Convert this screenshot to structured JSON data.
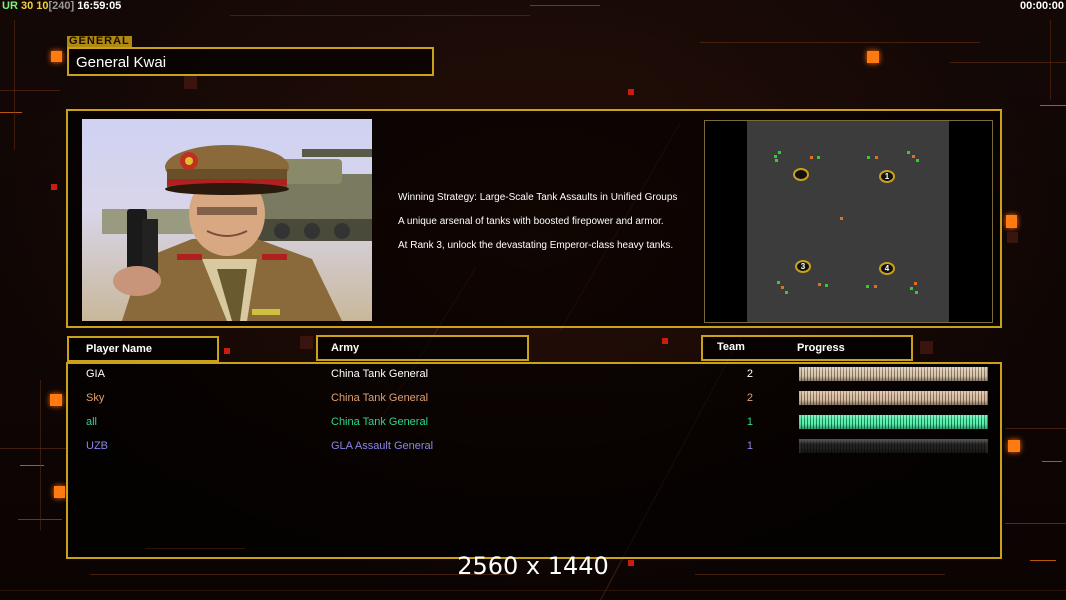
{
  "hud": {
    "ur_label": "UR",
    "fps": "30",
    "value10": "10",
    "bracket_value": "[240]",
    "clock": "16:59:05",
    "timer": "00:00:00"
  },
  "general": {
    "tag": "GENERAL",
    "name": "General Kwai",
    "portrait_icon": "general-portrait",
    "description": [
      "Winning Strategy: Large-Scale Tank Assaults in Unified Groups",
      "A unique arsenal of tanks with boosted firepower and armor.",
      "At Rank 3, unlock the devastating Emperor-class heavy tanks."
    ]
  },
  "minimap": {
    "start_positions": [
      "",
      "1",
      "3",
      "4"
    ]
  },
  "columns": {
    "player_name": "Player Name",
    "army": "Army",
    "team": "Team",
    "progress": "Progress"
  },
  "players": [
    {
      "name": "GIA",
      "army": "China Tank General",
      "team": "2",
      "progress": 1.0,
      "color": "#ffffff",
      "bar_color": "#d9c9b0",
      "bar_accent": "#8a7460"
    },
    {
      "name": "Sky",
      "army": "China Tank General",
      "team": "2",
      "progress": 1.0,
      "color": "#e0a070",
      "bar_color": "#d6c0a8",
      "bar_accent": "#8d6a50"
    },
    {
      "name": "all",
      "army": "China Tank General",
      "team": "1",
      "progress": 1.0,
      "color": "#2fd68a",
      "bar_color": "#5ef0b0",
      "bar_accent": "#138a5a"
    },
    {
      "name": "UZB",
      "army": "GLA Assault General",
      "team": "1",
      "progress": 1.0,
      "color": "#8a86e8",
      "bar_color": "#222222",
      "bar_accent": "#151515"
    }
  ],
  "resolution_text": "2560 x 1440",
  "colors": {
    "frame_gold": "#c9a21a",
    "accent_orange": "#ff7a10"
  }
}
